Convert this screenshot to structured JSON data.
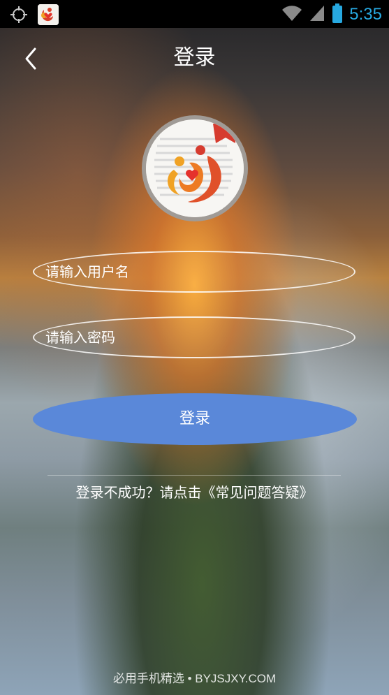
{
  "status_bar": {
    "time": "5:35",
    "icons": [
      "gps-icon",
      "app-notification-icon",
      "wifi-icon",
      "signal-icon",
      "battery-icon"
    ],
    "time_color": "#27a9e1"
  },
  "nav": {
    "title": "登录",
    "back_icon": "chevron-left-icon"
  },
  "form": {
    "username_placeholder": "请输入用户名",
    "password_placeholder": "请输入密码",
    "login_label": "登录",
    "button_color": "#5a88d9"
  },
  "help": {
    "text": "登录不成功？请点击《常见问题答疑》"
  },
  "watermark": {
    "text": "必用手机精选 • BYJSJXY.COM"
  }
}
